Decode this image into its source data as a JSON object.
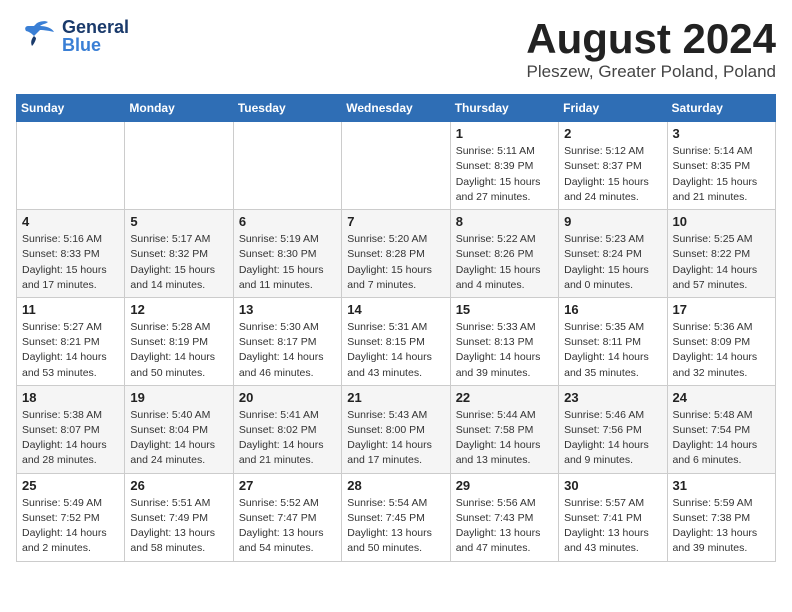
{
  "header": {
    "logo_general": "General",
    "logo_blue": "Blue",
    "month_year": "August 2024",
    "location": "Pleszew, Greater Poland, Poland"
  },
  "days_of_week": [
    "Sunday",
    "Monday",
    "Tuesday",
    "Wednesday",
    "Thursday",
    "Friday",
    "Saturday"
  ],
  "weeks": [
    [
      {
        "day": "",
        "info": ""
      },
      {
        "day": "",
        "info": ""
      },
      {
        "day": "",
        "info": ""
      },
      {
        "day": "",
        "info": ""
      },
      {
        "day": "1",
        "info": "Sunrise: 5:11 AM\nSunset: 8:39 PM\nDaylight: 15 hours\nand 27 minutes."
      },
      {
        "day": "2",
        "info": "Sunrise: 5:12 AM\nSunset: 8:37 PM\nDaylight: 15 hours\nand 24 minutes."
      },
      {
        "day": "3",
        "info": "Sunrise: 5:14 AM\nSunset: 8:35 PM\nDaylight: 15 hours\nand 21 minutes."
      }
    ],
    [
      {
        "day": "4",
        "info": "Sunrise: 5:16 AM\nSunset: 8:33 PM\nDaylight: 15 hours\nand 17 minutes."
      },
      {
        "day": "5",
        "info": "Sunrise: 5:17 AM\nSunset: 8:32 PM\nDaylight: 15 hours\nand 14 minutes."
      },
      {
        "day": "6",
        "info": "Sunrise: 5:19 AM\nSunset: 8:30 PM\nDaylight: 15 hours\nand 11 minutes."
      },
      {
        "day": "7",
        "info": "Sunrise: 5:20 AM\nSunset: 8:28 PM\nDaylight: 15 hours\nand 7 minutes."
      },
      {
        "day": "8",
        "info": "Sunrise: 5:22 AM\nSunset: 8:26 PM\nDaylight: 15 hours\nand 4 minutes."
      },
      {
        "day": "9",
        "info": "Sunrise: 5:23 AM\nSunset: 8:24 PM\nDaylight: 15 hours\nand 0 minutes."
      },
      {
        "day": "10",
        "info": "Sunrise: 5:25 AM\nSunset: 8:22 PM\nDaylight: 14 hours\nand 57 minutes."
      }
    ],
    [
      {
        "day": "11",
        "info": "Sunrise: 5:27 AM\nSunset: 8:21 PM\nDaylight: 14 hours\nand 53 minutes."
      },
      {
        "day": "12",
        "info": "Sunrise: 5:28 AM\nSunset: 8:19 PM\nDaylight: 14 hours\nand 50 minutes."
      },
      {
        "day": "13",
        "info": "Sunrise: 5:30 AM\nSunset: 8:17 PM\nDaylight: 14 hours\nand 46 minutes."
      },
      {
        "day": "14",
        "info": "Sunrise: 5:31 AM\nSunset: 8:15 PM\nDaylight: 14 hours\nand 43 minutes."
      },
      {
        "day": "15",
        "info": "Sunrise: 5:33 AM\nSunset: 8:13 PM\nDaylight: 14 hours\nand 39 minutes."
      },
      {
        "day": "16",
        "info": "Sunrise: 5:35 AM\nSunset: 8:11 PM\nDaylight: 14 hours\nand 35 minutes."
      },
      {
        "day": "17",
        "info": "Sunrise: 5:36 AM\nSunset: 8:09 PM\nDaylight: 14 hours\nand 32 minutes."
      }
    ],
    [
      {
        "day": "18",
        "info": "Sunrise: 5:38 AM\nSunset: 8:07 PM\nDaylight: 14 hours\nand 28 minutes."
      },
      {
        "day": "19",
        "info": "Sunrise: 5:40 AM\nSunset: 8:04 PM\nDaylight: 14 hours\nand 24 minutes."
      },
      {
        "day": "20",
        "info": "Sunrise: 5:41 AM\nSunset: 8:02 PM\nDaylight: 14 hours\nand 21 minutes."
      },
      {
        "day": "21",
        "info": "Sunrise: 5:43 AM\nSunset: 8:00 PM\nDaylight: 14 hours\nand 17 minutes."
      },
      {
        "day": "22",
        "info": "Sunrise: 5:44 AM\nSunset: 7:58 PM\nDaylight: 14 hours\nand 13 minutes."
      },
      {
        "day": "23",
        "info": "Sunrise: 5:46 AM\nSunset: 7:56 PM\nDaylight: 14 hours\nand 9 minutes."
      },
      {
        "day": "24",
        "info": "Sunrise: 5:48 AM\nSunset: 7:54 PM\nDaylight: 14 hours\nand 6 minutes."
      }
    ],
    [
      {
        "day": "25",
        "info": "Sunrise: 5:49 AM\nSunset: 7:52 PM\nDaylight: 14 hours\nand 2 minutes."
      },
      {
        "day": "26",
        "info": "Sunrise: 5:51 AM\nSunset: 7:49 PM\nDaylight: 13 hours\nand 58 minutes."
      },
      {
        "day": "27",
        "info": "Sunrise: 5:52 AM\nSunset: 7:47 PM\nDaylight: 13 hours\nand 54 minutes."
      },
      {
        "day": "28",
        "info": "Sunrise: 5:54 AM\nSunset: 7:45 PM\nDaylight: 13 hours\nand 50 minutes."
      },
      {
        "day": "29",
        "info": "Sunrise: 5:56 AM\nSunset: 7:43 PM\nDaylight: 13 hours\nand 47 minutes."
      },
      {
        "day": "30",
        "info": "Sunrise: 5:57 AM\nSunset: 7:41 PM\nDaylight: 13 hours\nand 43 minutes."
      },
      {
        "day": "31",
        "info": "Sunrise: 5:59 AM\nSunset: 7:38 PM\nDaylight: 13 hours\nand 39 minutes."
      }
    ]
  ]
}
